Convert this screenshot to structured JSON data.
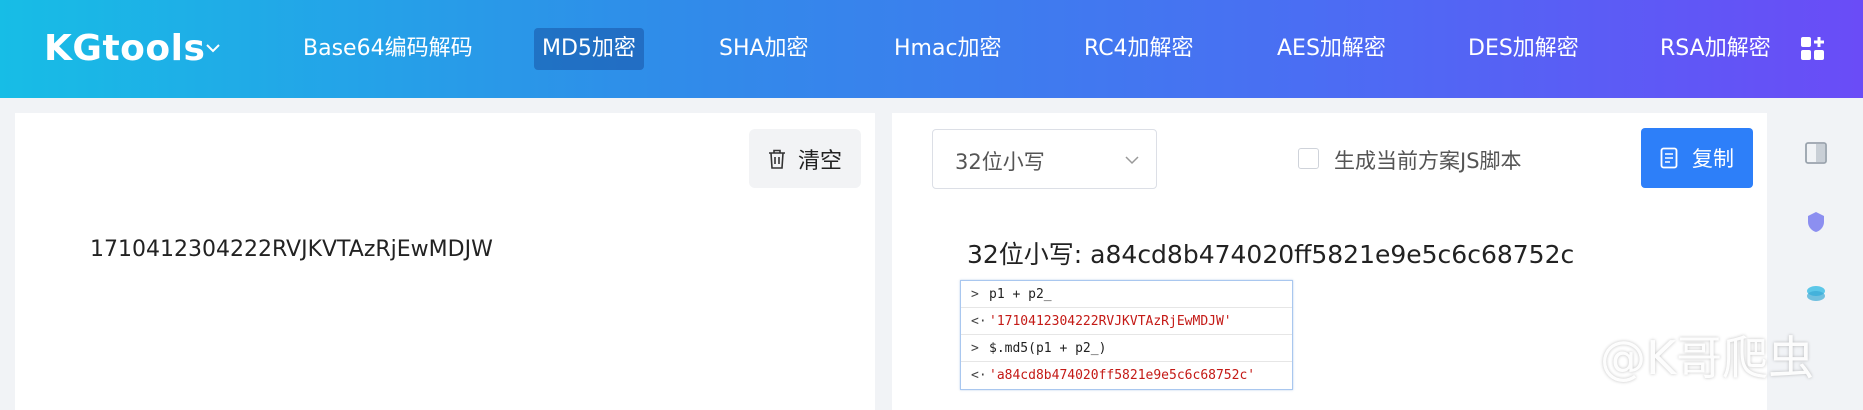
{
  "header": {
    "logo": "KGtools",
    "nav": [
      {
        "label": "Base64编码解码",
        "active": false
      },
      {
        "label": "MD5加密",
        "active": true
      },
      {
        "label": "SHA加密",
        "active": false
      },
      {
        "label": "Hmac加密",
        "active": false
      },
      {
        "label": "RC4加解密",
        "active": false
      },
      {
        "label": "AES加解密",
        "active": false
      },
      {
        "label": "DES加解密",
        "active": false
      },
      {
        "label": "RSA加解密",
        "active": false
      }
    ],
    "icons": {
      "logo_caret": "chevron-down-icon",
      "apps": "apps-plus-icon"
    }
  },
  "left_panel": {
    "clear_button": "清空",
    "clear_icon": "trash-icon",
    "input_text": "1710412304222RVJKVTAzRjEwMDJW"
  },
  "right_panel": {
    "select_value": "32位小写",
    "checkbox_label": "生成当前方案JS脚本",
    "checkbox_checked": false,
    "copy_button": "复制",
    "copy_icon": "copy-icon",
    "result": "32位小写: a84cd8b474020ff5821e9e5c6c68752c"
  },
  "console": {
    "rows": [
      {
        "arrow": ">",
        "text": "p1 + p2_",
        "kind": "cmd"
      },
      {
        "arrow": "<·",
        "text": "'1710412304222RVJKVTAzRjEwMDJW'",
        "kind": "str"
      },
      {
        "arrow": ">",
        "text": "$.md5(p1 + p2_)",
        "kind": "cmd"
      },
      {
        "arrow": "<·",
        "text": "'a84cd8b474020ff5821e9e5c6c68752c'",
        "kind": "str"
      }
    ]
  },
  "sidebar_icons": [
    "panel-toggle-icon",
    "shield-icon",
    "layers-icon"
  ],
  "watermark": "@K哥爬虫",
  "colors": {
    "primary": "#2d7ff9",
    "header_start": "#17bde6",
    "header_end": "#6a4cf7"
  }
}
